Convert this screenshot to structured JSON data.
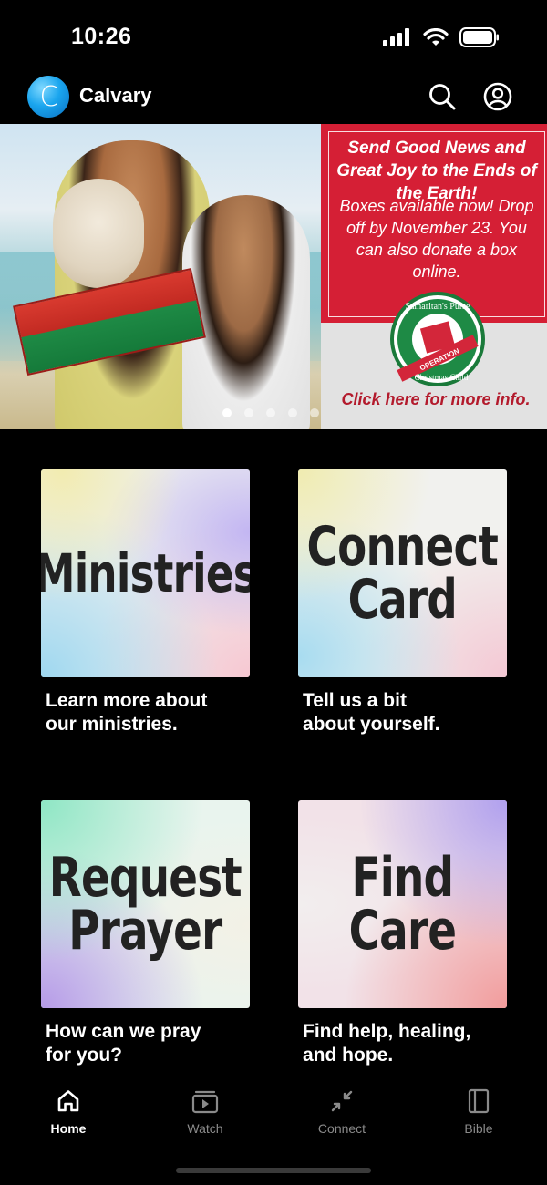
{
  "status_bar": {
    "time": "10:26"
  },
  "header": {
    "app_name": "Calvary",
    "logo_letter": "C"
  },
  "banner": {
    "headline": "Send Good News and Great Joy to the Ends of the Earth!",
    "body": "Boxes available now! Drop off by November 23. You can also donate a box online.",
    "logo_text_top": "Samaritan's Purse",
    "logo_text_band": "OPERATION",
    "logo_text_bottom": "Christmas Child",
    "cta": "Click here for more info.",
    "page_count": 5,
    "active_page": 1
  },
  "cards": [
    {
      "title_line1": "Ministries",
      "title_line2": "",
      "caption_line1": "Learn more about",
      "caption_line2": "our ministries."
    },
    {
      "title_line1": "Connect",
      "title_line2": "Card",
      "caption_line1": "Tell us a bit",
      "caption_line2": "about yourself."
    },
    {
      "title_line1": "Request",
      "title_line2": "Prayer",
      "caption_line1": "How can we pray",
      "caption_line2": "for you?"
    },
    {
      "title_line1": "Find",
      "title_line2": "Care",
      "caption_line1": "Find help, healing,",
      "caption_line2": "and hope."
    }
  ],
  "tabs": [
    {
      "label": "Home",
      "icon": "home-icon",
      "active": true
    },
    {
      "label": "Watch",
      "icon": "watch-icon",
      "active": false
    },
    {
      "label": "Connect",
      "icon": "connect-icon",
      "active": false
    },
    {
      "label": "Bible",
      "icon": "bible-icon",
      "active": false
    }
  ],
  "colors": {
    "background": "#000000",
    "banner_red": "#d51f35",
    "cta_red": "#b31a2c",
    "tab_inactive": "#8a8a8a"
  }
}
